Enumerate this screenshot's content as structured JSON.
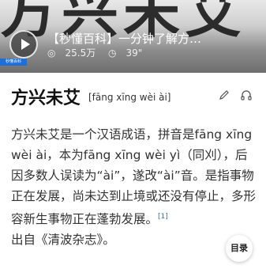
{
  "video": {
    "title": "【秒懂百科】一分钟了解方…",
    "views": "25.5万",
    "duration": "39\"",
    "background_text": "方兴未艾",
    "badge": "秒懂百科"
  },
  "entry": {
    "title": "方兴未艾",
    "pinyin": "[fāng xīng wèi ài]"
  },
  "body": {
    "text": "方兴未艾是一个汉语成语，拼音是fāng xīng wèi ài，本为fāng xīng wèi yì（同刈），后因多数人误读为“ài”，遂改“ài”音。是指事物正在发展，尚未达到止境或还没有停止，多形容新生事物正在蓬勃发展。",
    "ref": "[1]",
    "tail": "出自《清波杂志》。"
  },
  "toc_label": "目录",
  "colors": {
    "badge": "#1e6fd9",
    "ref": "#3a6ea5"
  }
}
